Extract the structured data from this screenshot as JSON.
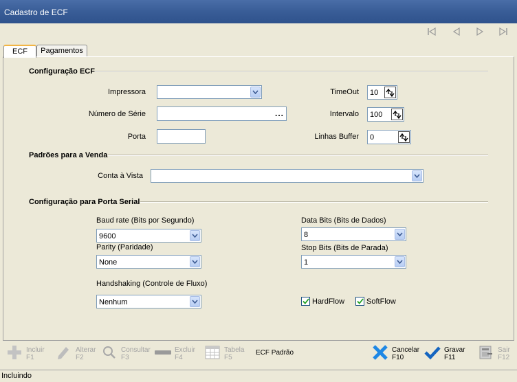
{
  "window": {
    "title": "Cadastro de ECF"
  },
  "tabs": [
    {
      "label": "ECF",
      "active": true
    },
    {
      "label": "Pagamentos",
      "active": false
    }
  ],
  "ecf_config": {
    "section_title": "Configuração ECF",
    "impressora": {
      "label": "Impressora",
      "value": ""
    },
    "numero_serie": {
      "label": "Número de Série",
      "value": "",
      "button": "..."
    },
    "porta": {
      "label": "Porta",
      "value": ""
    },
    "timeout": {
      "label": "TimeOut",
      "value": "10"
    },
    "intervalo": {
      "label": "Intervalo",
      "value": "100"
    },
    "linhas_buffer": {
      "label": "Linhas Buffer",
      "value": "0"
    }
  },
  "venda": {
    "section_title": "Padrões para a Venda",
    "conta_vista": {
      "label": "Conta à Vista",
      "value": ""
    }
  },
  "serial": {
    "section_title": "Configuração para Porta Serial",
    "baud_rate": {
      "label": "Baud rate (Bits por Segundo)",
      "value": "9600"
    },
    "parity": {
      "label": "Parity (Paridade)",
      "value": "None"
    },
    "handshaking": {
      "label": "Handshaking (Controle de Fluxo)",
      "value": "Nenhum"
    },
    "data_bits": {
      "label": "Data Bits (Bits de Dados)",
      "value": "8"
    },
    "stop_bits": {
      "label": "Stop Bits (Bits de Parada)",
      "value": "1"
    },
    "hardflow": {
      "label": "HardFlow",
      "checked": true
    },
    "softflow": {
      "label": "SoftFlow",
      "checked": true
    }
  },
  "toolbar": {
    "incluir": {
      "label": "Incluir",
      "key": "F1"
    },
    "alterar": {
      "label": "Alterar",
      "key": "F2"
    },
    "consultar": {
      "label": "Consultar",
      "key": "F3"
    },
    "excluir": {
      "label": "Excluir",
      "key": "F4"
    },
    "tabela": {
      "label": "Tabela",
      "key": "F5"
    },
    "ecf_padrao": {
      "label": "ECF Padrão"
    },
    "cancelar": {
      "label": "Cancelar",
      "key": "F10"
    },
    "gravar": {
      "label": "Gravar",
      "key": "F11"
    },
    "sair": {
      "label": "Sair",
      "key": "F12"
    }
  },
  "status": {
    "text": "Incluindo"
  },
  "colors": {
    "title_bar": "#3a5e98",
    "cancel": "#1e88e5",
    "accent_tab": "#f2b544"
  }
}
